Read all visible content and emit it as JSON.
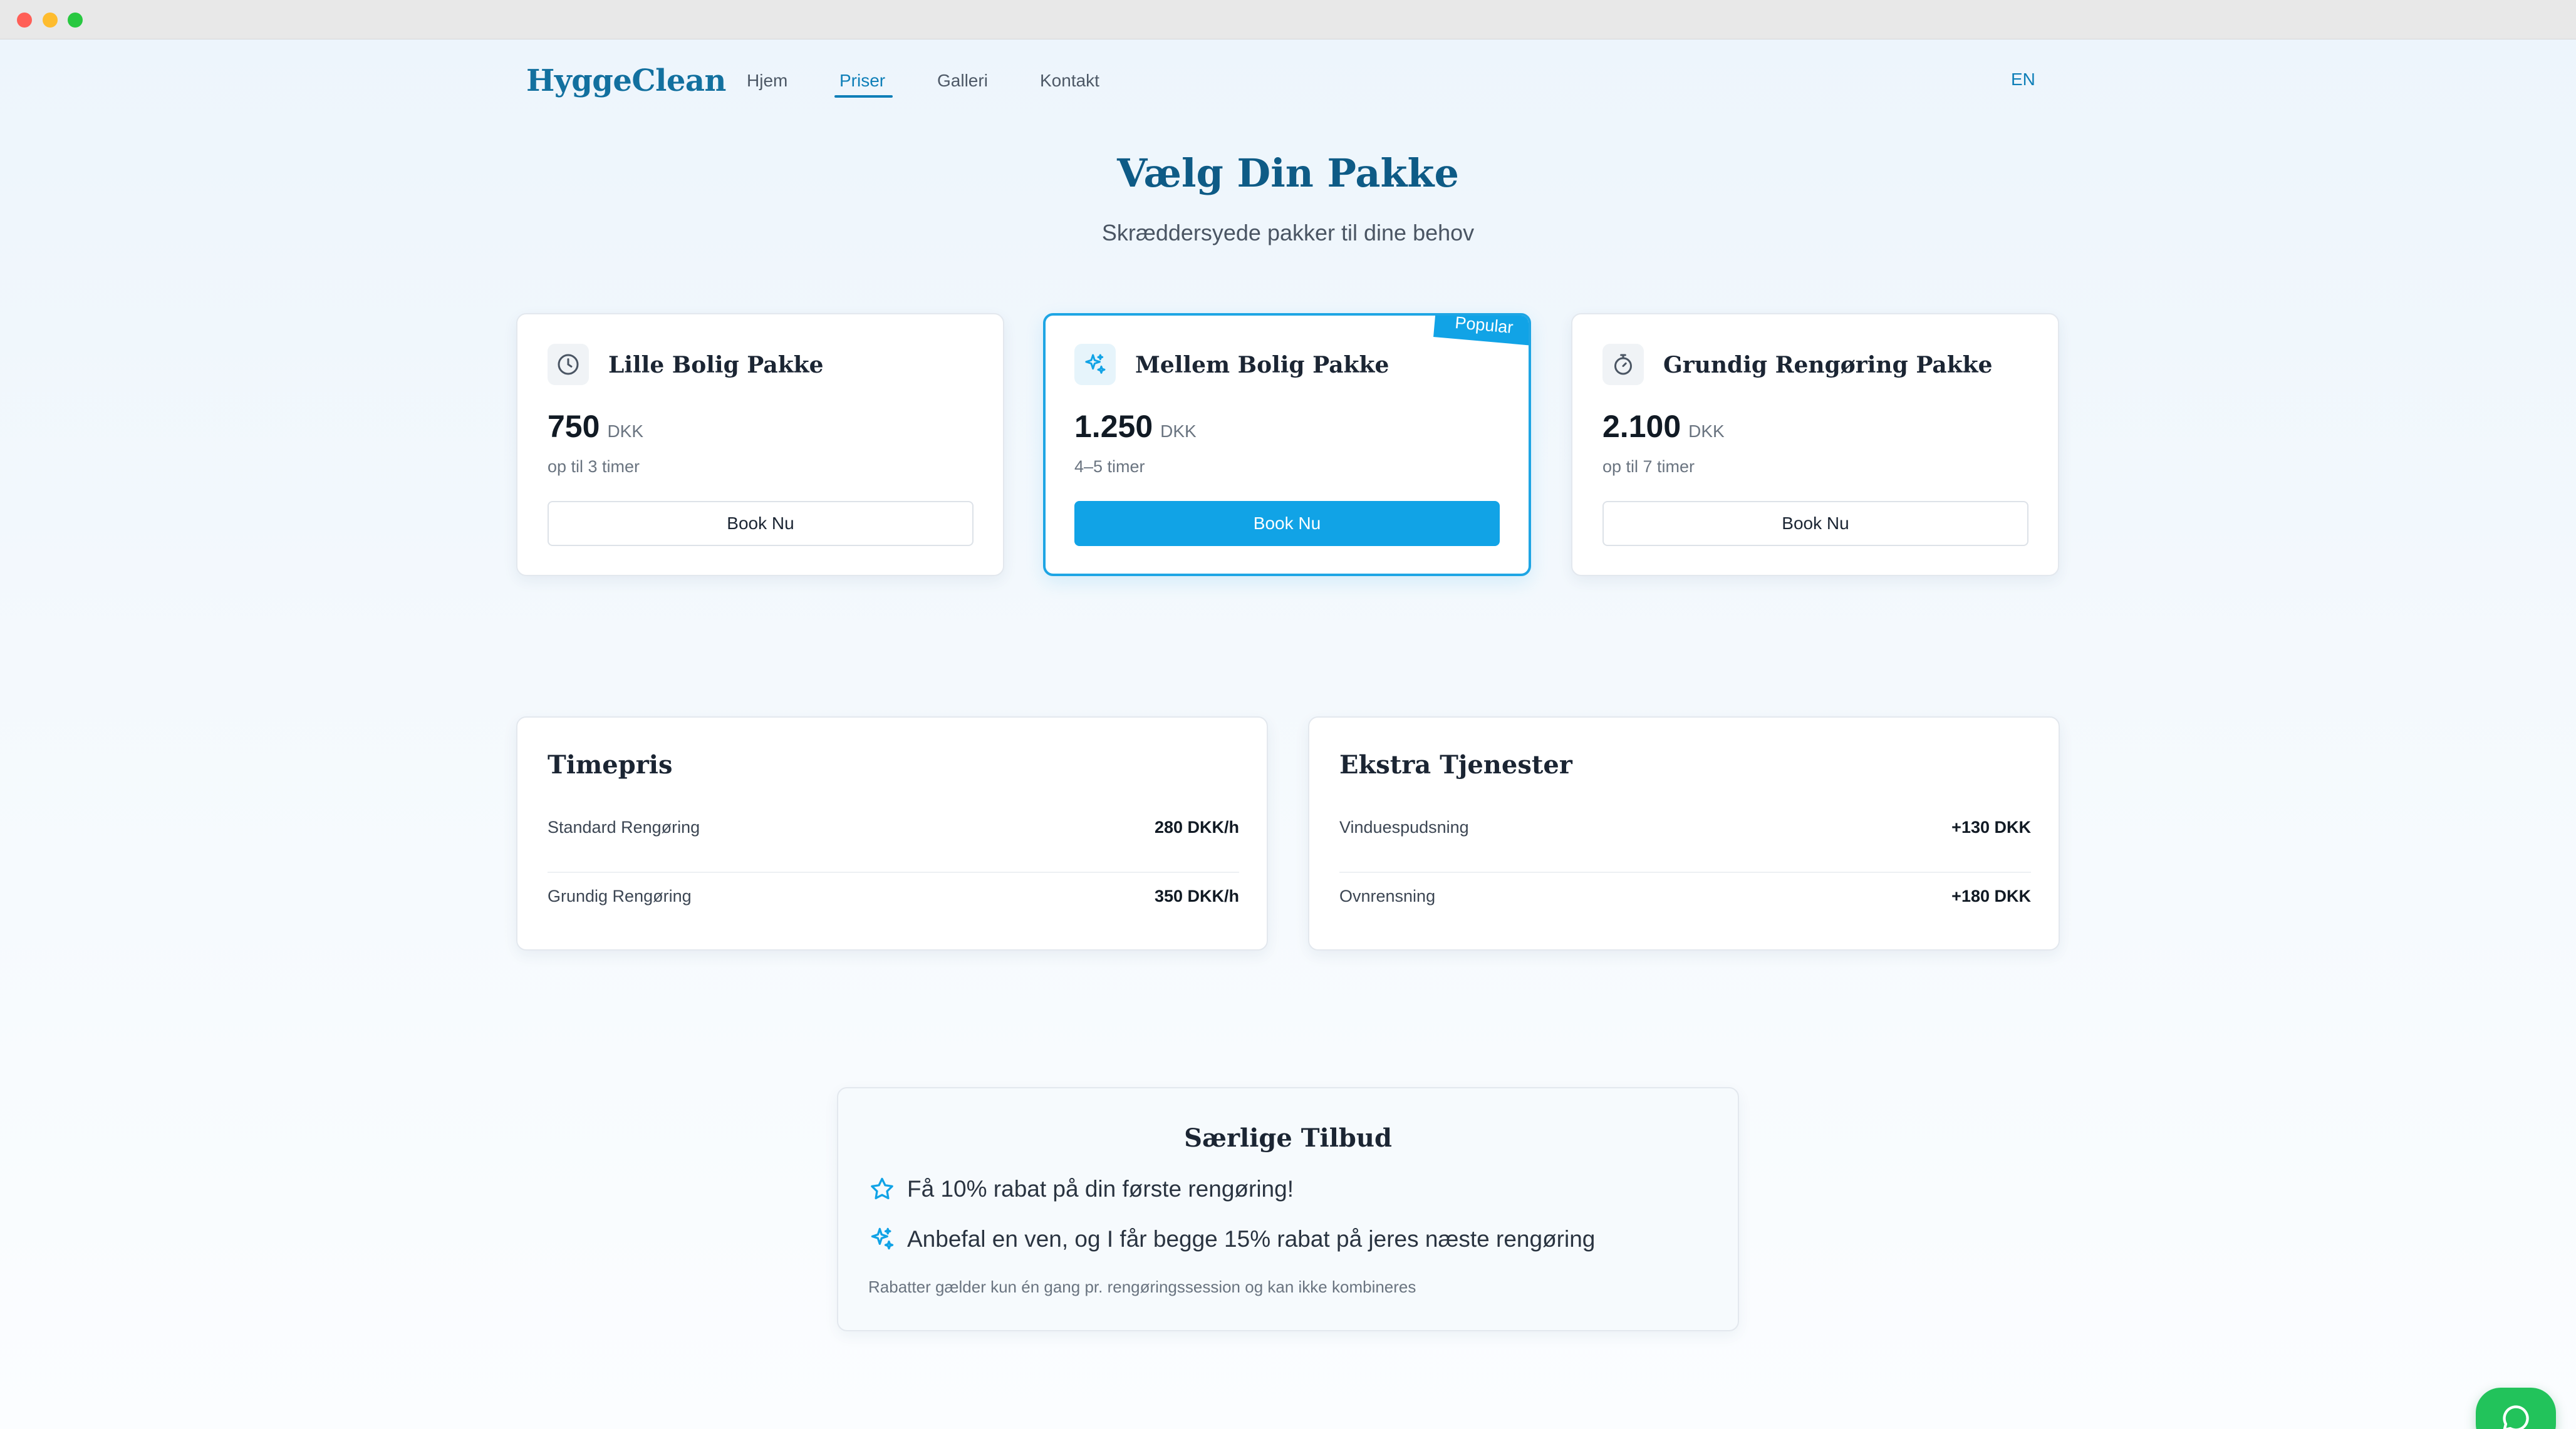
{
  "brand": {
    "name": "HyggeClean"
  },
  "nav": {
    "items": [
      {
        "label": "Hjem"
      },
      {
        "label": "Priser"
      },
      {
        "label": "Galleri"
      },
      {
        "label": "Kontakt"
      }
    ],
    "active": "Priser",
    "language": "EN"
  },
  "hero": {
    "title": "Vælg Din Pakke",
    "subtitle": "Skræddersyede pakker til dine behov"
  },
  "packages": [
    {
      "icon": "clock-icon",
      "name": "Lille Bolig Pakke",
      "price": "750",
      "currency": "DKK",
      "duration": "op til 3 timer",
      "button": "Book Nu"
    },
    {
      "icon": "sparkles-icon",
      "name": "Mellem Bolig Pakke",
      "price": "1.250",
      "currency": "DKK",
      "duration": "4–5 timer",
      "button": "Book Nu",
      "badge": "Popular"
    },
    {
      "icon": "timer-icon",
      "name": "Grundig Rengøring Pakke",
      "price": "2.100",
      "currency": "DKK",
      "duration": "op til 7 timer",
      "button": "Book Nu"
    }
  ],
  "hourly": {
    "title": "Timepris",
    "rows": [
      {
        "label": "Standard Rengøring",
        "value": "280 DKK/h"
      },
      {
        "label": "Grundig Rengøring",
        "value": "350 DKK/h"
      }
    ]
  },
  "extras": {
    "title": "Ekstra Tjenester",
    "rows": [
      {
        "label": "Vinduespudsning",
        "value": "+130 DKK"
      },
      {
        "label": "Ovnrensning",
        "value": "+180 DKK"
      }
    ]
  },
  "offers": {
    "title": "Særlige Tilbud",
    "items": [
      {
        "icon": "star-icon",
        "text": "Få 10% rabat på din første rengøring!"
      },
      {
        "icon": "sparkles-icon",
        "text": "Anbefal en ven, og I får begge 15% rabat på jeres næste rengøring"
      }
    ],
    "note": "Rabatter gælder kun én gang pr. rengøringssession og kan ikke kombineres"
  },
  "chat": {
    "icon": "chat-bubble-icon"
  },
  "colors": {
    "accent": "#11a3e6",
    "brand": "#12709f",
    "heading": "#0e5b86",
    "chat": "#22c35b"
  }
}
